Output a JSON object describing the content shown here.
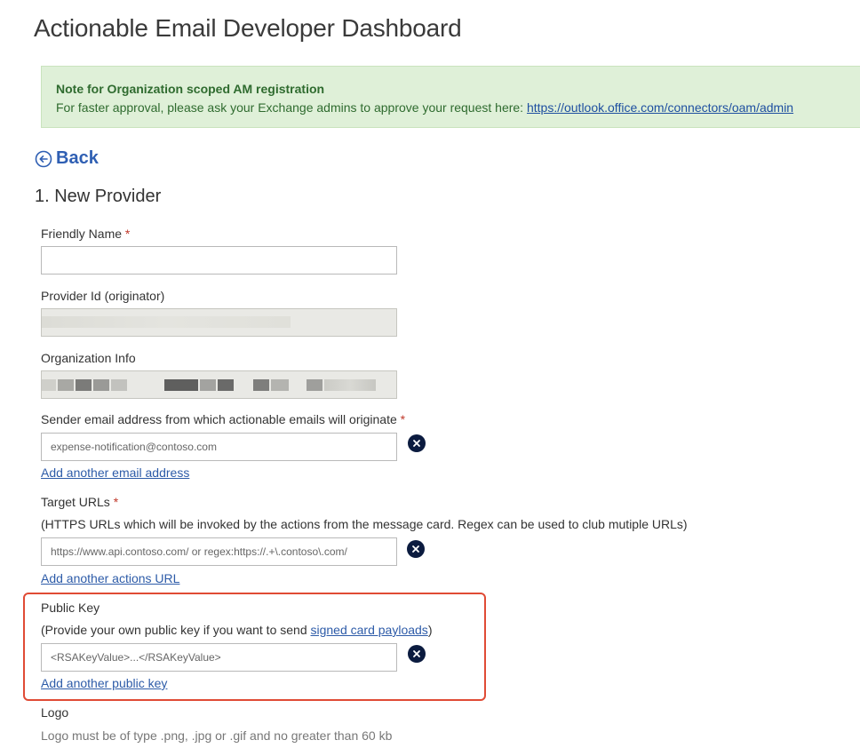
{
  "page": {
    "title": "Actionable Email Developer Dashboard"
  },
  "note": {
    "title": "Note for Organization scoped AM registration",
    "body_prefix": "For faster approval, please ask your Exchange admins to approve your request here: ",
    "link": "https://outlook.office.com/connectors/oam/admin"
  },
  "nav": {
    "back_label": "Back"
  },
  "form": {
    "section_title": "1. New Provider",
    "friendly_name": {
      "label": "Friendly Name",
      "required_mark": "*",
      "value": ""
    },
    "provider_id": {
      "label": "Provider Id (originator)"
    },
    "organization_info": {
      "label": "Organization Info"
    },
    "sender_email": {
      "label": "Sender email address from which actionable emails will originate",
      "required_mark": "*",
      "placeholder": "expense-notification@contoso.com",
      "add_link": "Add another email address"
    },
    "target_urls": {
      "label": "Target URLs",
      "required_mark": "*",
      "help": "(HTTPS URLs which will be invoked by the actions from the message card. Regex can be used to club mutiple URLs)",
      "placeholder": "https://www.api.contoso.com/ or regex:https://.+\\.contoso\\.com/",
      "add_link": "Add another actions URL"
    },
    "public_key": {
      "label": "Public Key",
      "help_prefix": "(Provide your own public key if you want to send ",
      "help_link": "signed card payloads",
      "help_suffix": ")",
      "placeholder": "<RSAKeyValue>...</RSAKeyValue>",
      "add_link": "Add another public key"
    },
    "logo": {
      "label": "Logo",
      "help": "Logo must be of type .png, .jpg or .gif and no greater than 60 kb"
    }
  },
  "colors": {
    "accent_link": "#2d5ba8",
    "note_background": "#dff0d8",
    "highlight_border": "#e04b35",
    "remove_icon": "#0b1b3f"
  },
  "icons": {
    "back": "circle-arrow-left-icon",
    "remove": "close-circle-icon"
  }
}
